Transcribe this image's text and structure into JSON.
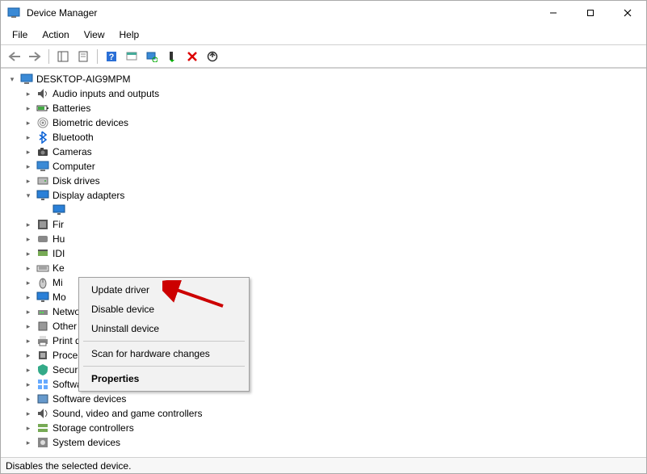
{
  "window": {
    "title": "Device Manager"
  },
  "menubar": {
    "items": [
      "File",
      "Action",
      "View",
      "Help"
    ]
  },
  "toolbar": {
    "buttons": [
      {
        "name": "back-button",
        "icon": "arrow-left"
      },
      {
        "name": "forward-button",
        "icon": "arrow-right"
      },
      {
        "name": "sep"
      },
      {
        "name": "show-hide-tree-button",
        "icon": "panel"
      },
      {
        "name": "properties-button",
        "icon": "sheet"
      },
      {
        "name": "sep"
      },
      {
        "name": "help-button",
        "icon": "help"
      },
      {
        "name": "sep"
      },
      {
        "name": "scan-hardware-button",
        "icon": "monitor-scan"
      },
      {
        "name": "update-driver-button",
        "icon": "monitor-up"
      },
      {
        "name": "enable-device-button",
        "icon": "device-enable"
      },
      {
        "name": "disable-device-button",
        "icon": "device-disable"
      },
      {
        "name": "uninstall-device-button",
        "icon": "device-uninstall"
      }
    ]
  },
  "tree": {
    "root": {
      "label": "DESKTOP-AIG9MPM",
      "expanded": true
    },
    "children": [
      {
        "label": "Audio inputs and outputs",
        "icon": "audio",
        "expanded": false
      },
      {
        "label": "Batteries",
        "icon": "battery",
        "expanded": false
      },
      {
        "label": "Biometric devices",
        "icon": "fingerprint",
        "expanded": false
      },
      {
        "label": "Bluetooth",
        "icon": "bluetooth",
        "expanded": false
      },
      {
        "label": "Cameras",
        "icon": "camera",
        "expanded": false
      },
      {
        "label": "Computer",
        "icon": "computer",
        "expanded": false
      },
      {
        "label": "Disk drives",
        "icon": "disk",
        "expanded": false
      },
      {
        "label": "Display adapters",
        "icon": "display",
        "expanded": true,
        "children": [
          {
            "label": "",
            "icon": "display-child"
          }
        ]
      },
      {
        "label": "Fir",
        "icon": "firmware",
        "expanded": false,
        "truncated": true
      },
      {
        "label": "Hu",
        "icon": "hid",
        "expanded": false,
        "truncated": true
      },
      {
        "label": "IDI",
        "icon": "ide",
        "expanded": false,
        "truncated": true
      },
      {
        "label": "Ke",
        "icon": "keyboard",
        "expanded": false,
        "truncated": true
      },
      {
        "label": "Mi",
        "icon": "mouse",
        "expanded": false,
        "truncated": true
      },
      {
        "label": "Mo",
        "icon": "monitor",
        "expanded": false,
        "truncated": true
      },
      {
        "label": "Network adapters",
        "icon": "network",
        "expanded": false
      },
      {
        "label": "Other devices",
        "icon": "other",
        "expanded": false
      },
      {
        "label": "Print queues",
        "icon": "printer",
        "expanded": false
      },
      {
        "label": "Processors",
        "icon": "cpu",
        "expanded": false
      },
      {
        "label": "Security devices",
        "icon": "security",
        "expanded": false
      },
      {
        "label": "Software components",
        "icon": "swcomp",
        "expanded": false
      },
      {
        "label": "Software devices",
        "icon": "swdev",
        "expanded": false
      },
      {
        "label": "Sound, video and game controllers",
        "icon": "sound",
        "expanded": false
      },
      {
        "label": "Storage controllers",
        "icon": "storage",
        "expanded": false
      },
      {
        "label": "System devices",
        "icon": "system",
        "expanded": false,
        "cutoff": true
      }
    ]
  },
  "context_menu": {
    "items": [
      {
        "label": "Update driver",
        "name": "ctx-update-driver"
      },
      {
        "label": "Disable device",
        "name": "ctx-disable-device"
      },
      {
        "label": "Uninstall device",
        "name": "ctx-uninstall-device"
      },
      {
        "sep": true
      },
      {
        "label": "Scan for hardware changes",
        "name": "ctx-scan-hardware"
      },
      {
        "sep": true
      },
      {
        "label": "Properties",
        "name": "ctx-properties",
        "bold": true
      }
    ]
  },
  "statusbar": {
    "text": "Disables the selected device."
  }
}
